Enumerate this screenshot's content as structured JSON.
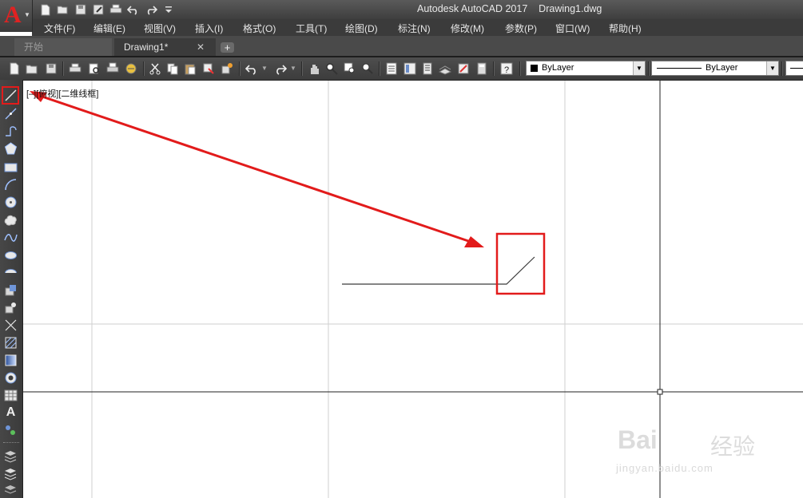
{
  "app": {
    "logo_letter": "A",
    "title": "Autodesk AutoCAD 2017    Drawing1.dwg"
  },
  "quick_access": [
    "new-icon",
    "open-icon",
    "save-icon",
    "save-as-icon",
    "plot-icon",
    "undo-icon",
    "redo-icon",
    "customize-icon"
  ],
  "menu": {
    "items": [
      "文件(F)",
      "编辑(E)",
      "视图(V)",
      "插入(I)",
      "格式(O)",
      "工具(T)",
      "绘图(D)",
      "标注(N)",
      "修改(M)",
      "参数(P)",
      "窗口(W)",
      "帮助(H)"
    ]
  },
  "tabs": {
    "start": "开始",
    "drawing": "Drawing1*",
    "close_glyph": "✕",
    "add_glyph": "+"
  },
  "toolbar": {
    "color_combo": "ByLayer",
    "linetype_combo": "ByLayer"
  },
  "left_toolbar": {
    "tools": [
      "line-icon",
      "construction-line-icon",
      "polyline-icon",
      "polygon-icon",
      "rectangle-icon",
      "arc-icon",
      "circle-icon",
      "revision-cloud-icon",
      "spline-icon",
      "ellipse-icon",
      "ellipse-arc-icon",
      "insert-block-icon",
      "make-block-icon",
      "point-icon",
      "hatch-icon",
      "gradient-icon",
      "region-icon",
      "table-icon",
      "multiline-text-icon",
      "add-selected-icon"
    ],
    "text_tool_glyph": "A"
  },
  "canvas": {
    "viewport_label": "[–][俯视][二维线框]",
    "watermark_brand": "Bai",
    "watermark_sub": "经验",
    "watermark_url": "jingyan.baidu.com"
  },
  "colors": {
    "accent_red": "#e21b1b",
    "autocad_logo_red": "#e02222",
    "ui_dark": "#3b3b3b",
    "canvas_bg": "#ffffff",
    "grid_line": "#cfcfcf"
  }
}
